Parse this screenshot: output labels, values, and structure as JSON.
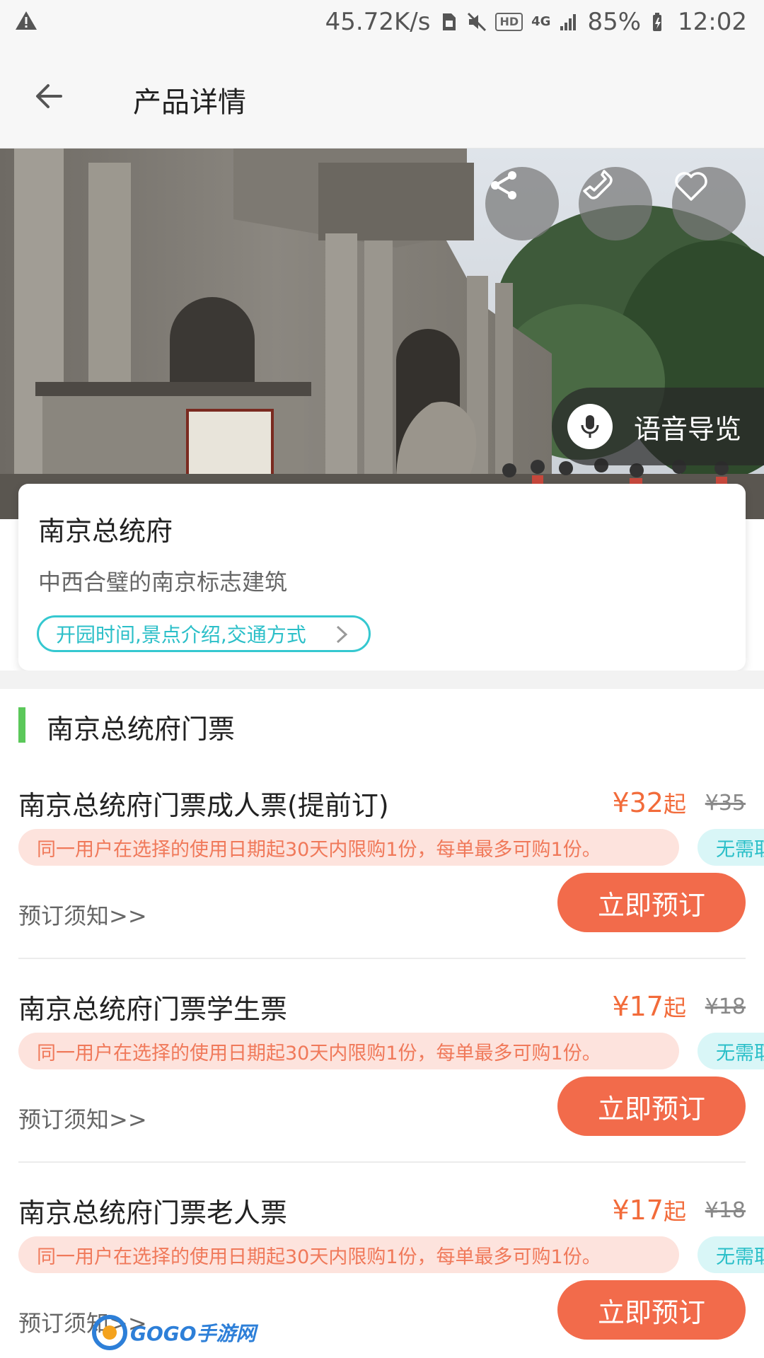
{
  "status_bar": {
    "speed": "45.72K/s",
    "hd": "HD",
    "network": "4G",
    "battery": "85%",
    "time": "12:02"
  },
  "app_bar": {
    "title": "产品详情"
  },
  "hero": {
    "voice_guide_label": "语音导览"
  },
  "info_card": {
    "name": "南京总统府",
    "description": "中西合璧的南京标志建筑",
    "details_link": "开园时间,景点介绍,交通方式"
  },
  "section": {
    "title": "南京总统府门票"
  },
  "tickets": [
    {
      "name": "南京总统府门票成人票(提前订)",
      "price": "¥32",
      "price_suffix": "起",
      "original_price": "¥35",
      "limit": "同一用户在选择的使用日期起30天内限购1份，每单最多可购1份。",
      "tag": "无需取",
      "notice": "预订须知>>",
      "book": "立即预订"
    },
    {
      "name": "南京总统府门票学生票",
      "price": "¥17",
      "price_suffix": "起",
      "original_price": "¥18",
      "limit": "同一用户在选择的使用日期起30天内限购1份，每单最多可购1份。",
      "tag": "无需取",
      "notice": "预订须知>>",
      "book": "立即预订"
    },
    {
      "name": "南京总统府门票老人票",
      "price": "¥17",
      "price_suffix": "起",
      "original_price": "¥18",
      "limit": "同一用户在选择的使用日期起30天内限购1份，每单最多可购1份。",
      "tag": "无需取",
      "notice": "预订须知>>",
      "book": "立即预订"
    }
  ],
  "watermark": {
    "text": "GOGO手游网"
  },
  "colors": {
    "accent_orange": "#f26b4b",
    "accent_teal": "#2bbfc8",
    "section_green": "#5bc85a"
  }
}
